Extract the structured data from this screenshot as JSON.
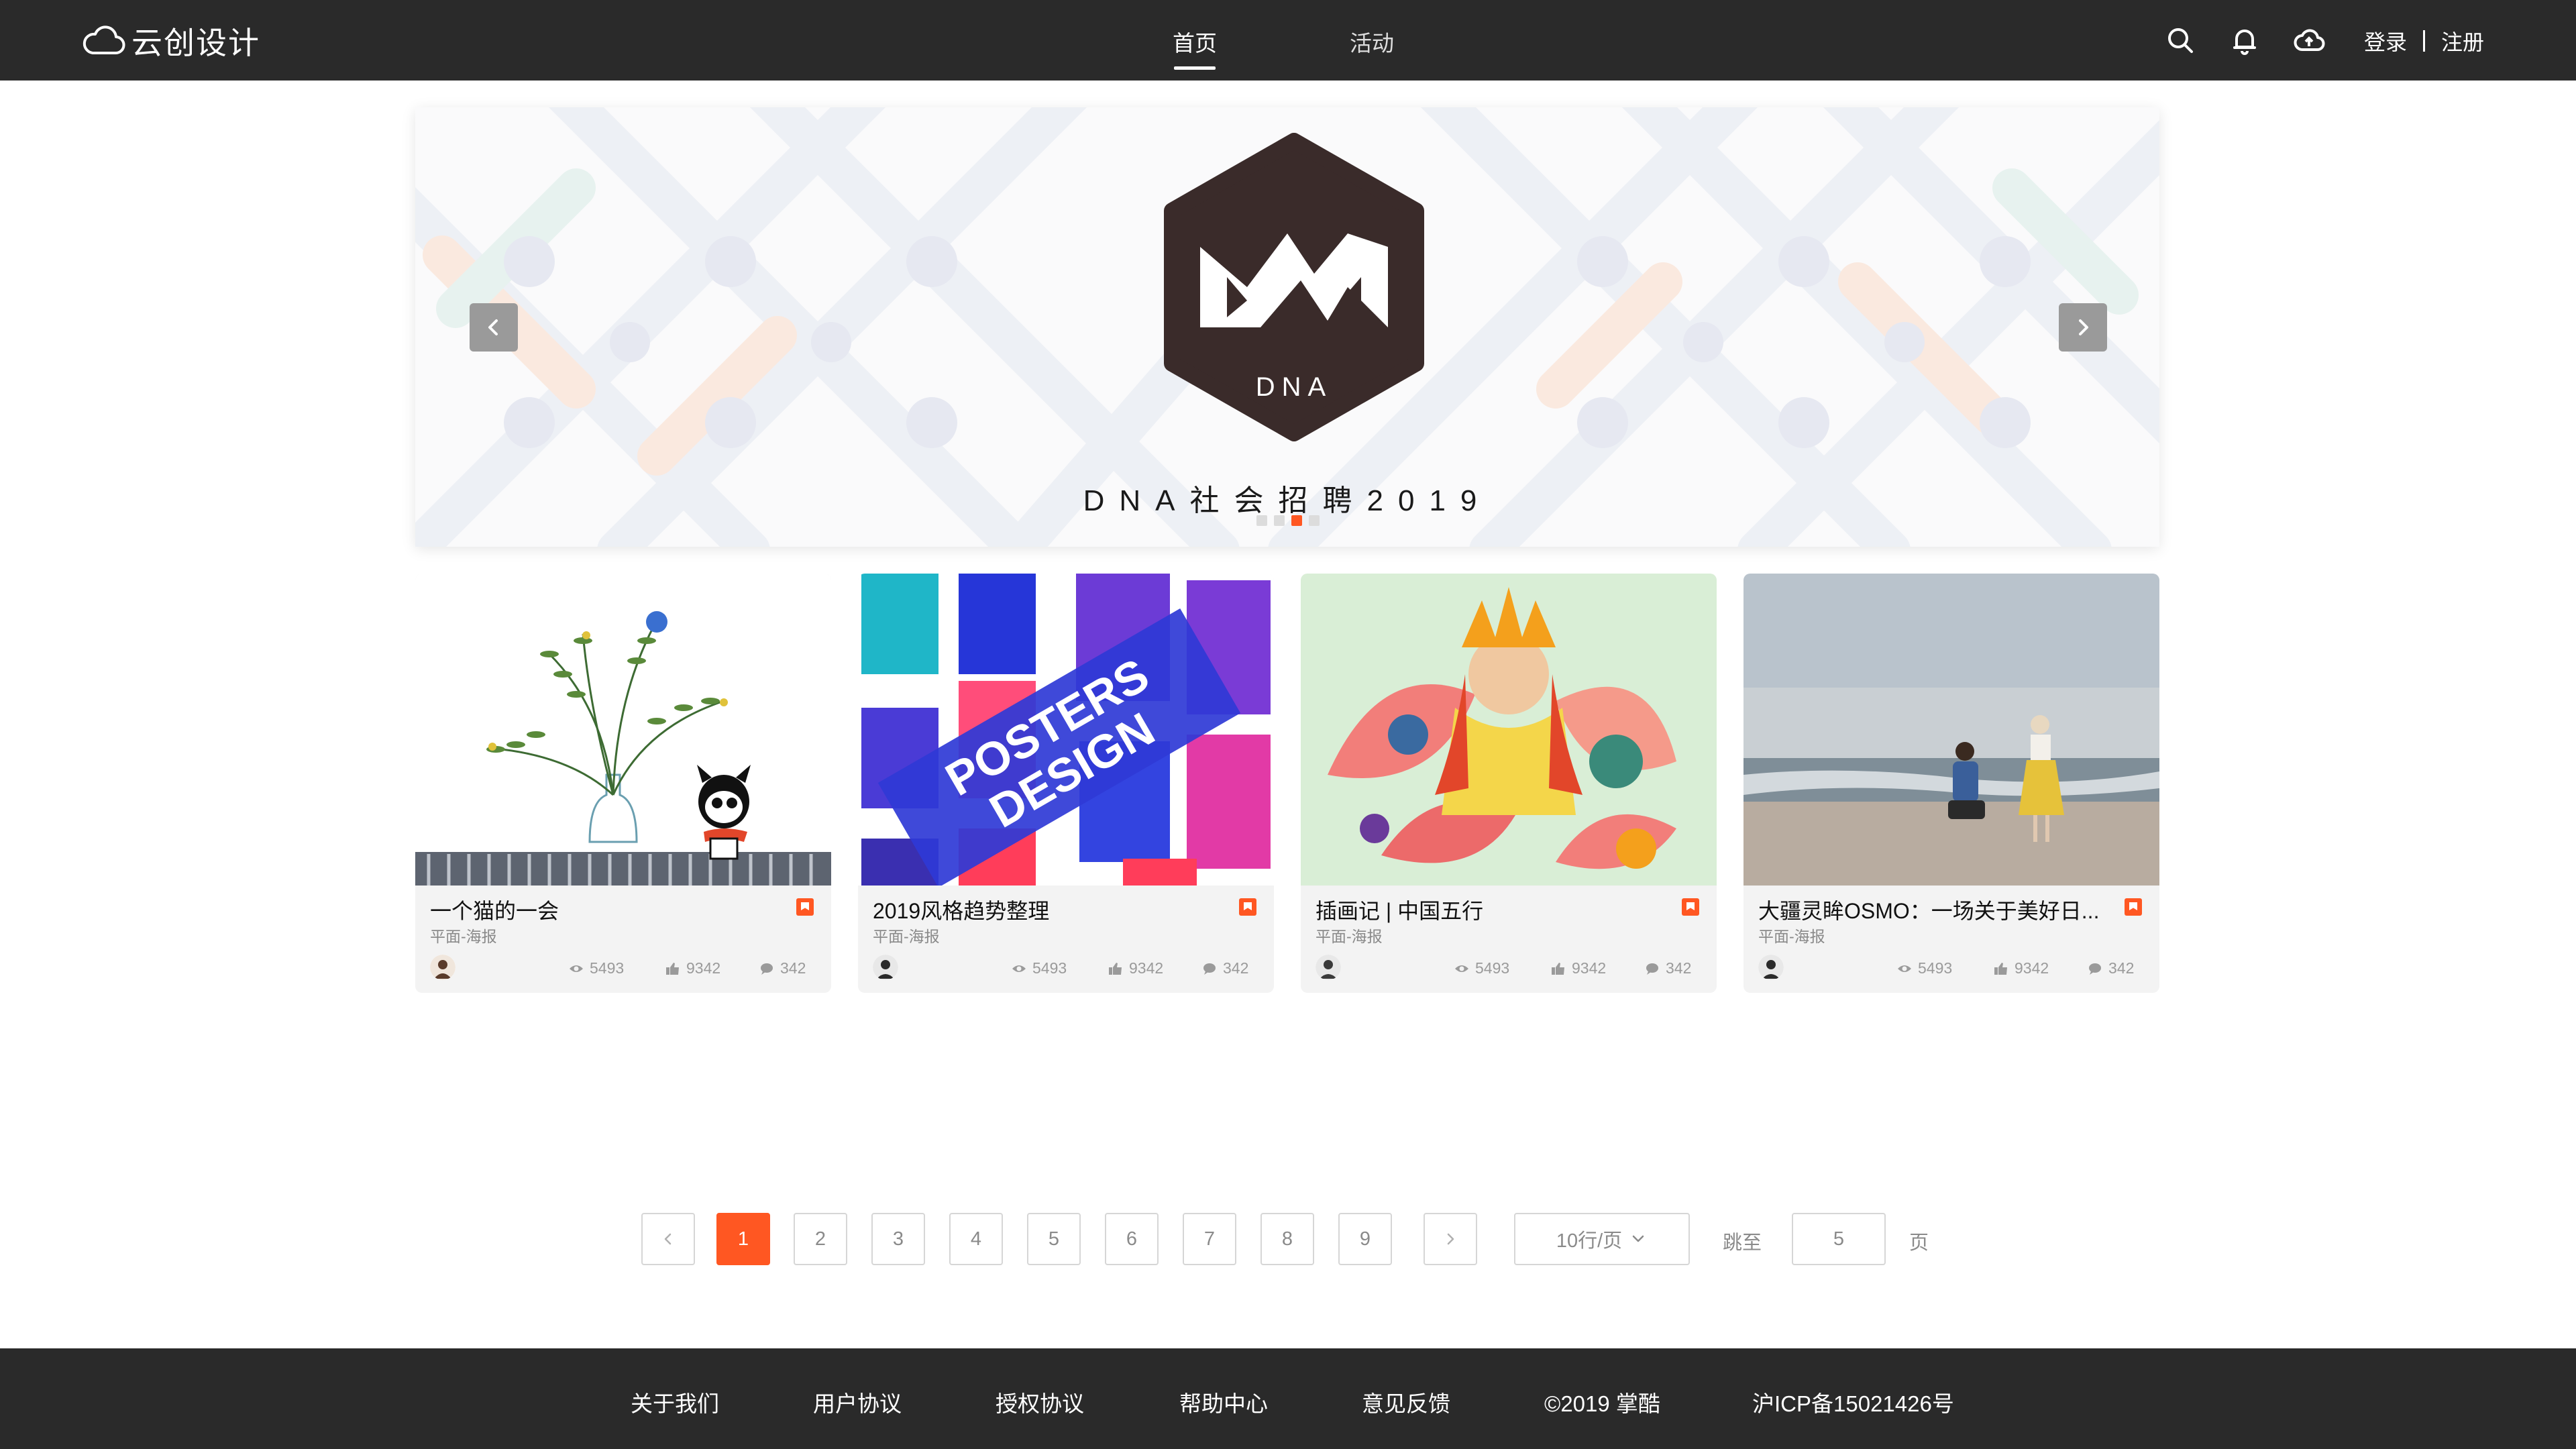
{
  "nav": {
    "logo_text": "云创设计",
    "tabs": [
      {
        "label": "首页",
        "active": true
      },
      {
        "label": "活动",
        "active": false
      }
    ],
    "icons": [
      "search-icon",
      "bell-icon",
      "cloud-upload-icon"
    ],
    "login_label": "登录",
    "register_label": "注册"
  },
  "banner": {
    "badge_text": "DNA",
    "title": "DNA社会招聘2019",
    "slide_count": 4,
    "active_slide": 3,
    "accent_color": "#ff5722"
  },
  "cards": [
    {
      "title": "一个猫的一会",
      "category": "平面-海报",
      "views": "5493",
      "likes": "9342",
      "comments": "342"
    },
    {
      "title": "2019风格趋势整理",
      "category": "平面-海报",
      "views": "5493",
      "likes": "9342",
      "comments": "342",
      "image_text": [
        "POSTERS",
        "DESIGN"
      ]
    },
    {
      "title": "插画记 | 中国五行",
      "category": "平面-海报",
      "views": "5493",
      "likes": "9342",
      "comments": "342"
    },
    {
      "title": "大疆灵眸OSMO：一场关于美好日...",
      "category": "平面-海报",
      "views": "5493",
      "likes": "9342",
      "comments": "342"
    }
  ],
  "pagination": {
    "pages": [
      "1",
      "2",
      "3",
      "4",
      "5",
      "6",
      "7",
      "8",
      "9"
    ],
    "current": "1",
    "page_size": "10行/页",
    "jump_label": "跳至",
    "jump_value": "5",
    "page_unit": "页"
  },
  "footer": {
    "links": [
      "关于我们",
      "用户协议",
      "授权协议",
      "帮助中心",
      "意见反馈",
      "©2019 掌酷",
      "沪ICP备15021426号"
    ]
  }
}
